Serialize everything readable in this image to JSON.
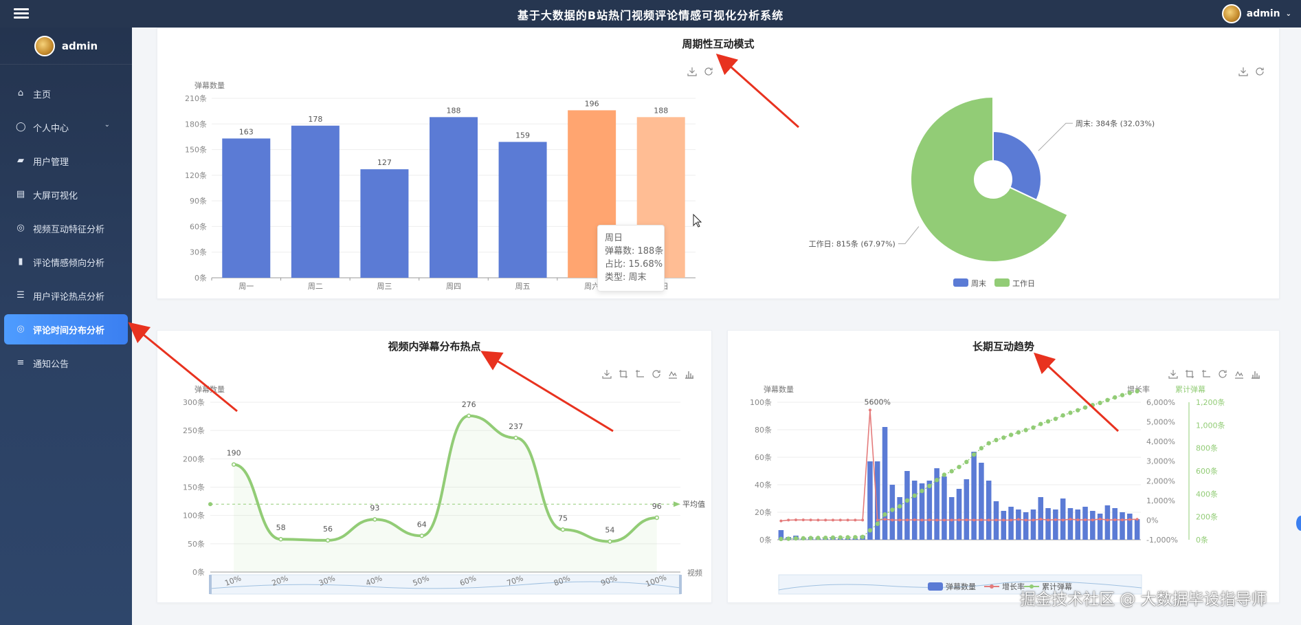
{
  "app": {
    "title": "基于大数据的B站热门视频评论情感可视化分析系统",
    "user": "admin"
  },
  "sidebar": {
    "user": "admin",
    "items": [
      {
        "label": "主页",
        "icon": "home-icon"
      },
      {
        "label": "个人中心",
        "icon": "user-icon",
        "has_children": true
      },
      {
        "label": "用户管理",
        "icon": "users-icon"
      },
      {
        "label": "大屏可视化",
        "icon": "clipboard-icon"
      },
      {
        "label": "视频互动特征分析",
        "icon": "compass-icon"
      },
      {
        "label": "评论情感倾向分析",
        "icon": "book-icon"
      },
      {
        "label": "用户评论热点分析",
        "icon": "sliders-icon"
      },
      {
        "label": "评论时间分布分析",
        "icon": "compass-icon",
        "active": true
      },
      {
        "label": "通知公告",
        "icon": "list-icon"
      }
    ]
  },
  "weekly": {
    "title": "周期性互动模式",
    "tooltip": {
      "line1": "周日",
      "line2": "弹幕数: 188条",
      "line3": "占比: 15.68%",
      "line4": "类型: 周末"
    }
  },
  "heat": {
    "title": "视频内弹幕分布热点"
  },
  "trend": {
    "title": "长期互动趋势"
  },
  "watermark": "掘金技术社区 @ 大数据毕设指导师",
  "colors": {
    "blue": "#5b7bd5",
    "orange": "#ffa570",
    "light_orange": "#ffbd94",
    "green": "#92cc76",
    "red": "#e47b7b",
    "accent": "#3b7ff0"
  },
  "chart_data": [
    {
      "type": "bar",
      "ylabel": "弹幕数量",
      "y_ticks": [
        "0条",
        "30条",
        "60条",
        "90条",
        "120条",
        "150条",
        "180条",
        "210条"
      ],
      "ylim": [
        0,
        210
      ],
      "categories": [
        "周一",
        "周二",
        "周三",
        "周四",
        "周五",
        "周六",
        "周日"
      ],
      "values": [
        163,
        178,
        127,
        188,
        159,
        196,
        188
      ],
      "data_labels": [
        "163",
        "178",
        "127",
        "188",
        "159",
        "196",
        "188"
      ],
      "bar_colors": [
        "#5b7bd5",
        "#5b7bd5",
        "#5b7bd5",
        "#5b7bd5",
        "#5b7bd5",
        "#ffa570",
        "#ffbd94"
      ]
    },
    {
      "type": "pie",
      "slices": [
        {
          "name": "周末",
          "value": 384,
          "percent": 32.03,
          "label": "周末: 384条 (32.03%)",
          "color": "#5b7bd5"
        },
        {
          "name": "工作日",
          "value": 815,
          "percent": 67.97,
          "label": "工作日: 815条 (67.97%)",
          "color": "#92cc76"
        }
      ],
      "legend": [
        "周末",
        "工作日"
      ],
      "legend_position": "bottom"
    },
    {
      "type": "line",
      "ylabel": "弹幕数量",
      "xlabel": "视频",
      "y_ticks": [
        "0条",
        "50条",
        "100条",
        "150条",
        "200条",
        "250条",
        "300条"
      ],
      "ylim": [
        0,
        300
      ],
      "x": [
        "10%",
        "20%",
        "30%",
        "40%",
        "50%",
        "60%",
        "70%",
        "80%",
        "90%",
        "100%"
      ],
      "values": [
        190,
        58,
        56,
        93,
        64,
        276,
        237,
        75,
        54,
        96
      ],
      "data_labels": [
        "190",
        "58",
        "56",
        "93",
        "64",
        "276",
        "237",
        "75",
        "54",
        "96"
      ],
      "mark_line": {
        "label": "平均值",
        "value": 120
      },
      "color": "#92cc76"
    },
    {
      "type": "bar",
      "ylabel": "弹幕数量",
      "y_ticks": [
        "0条",
        "20条",
        "40条",
        "60条",
        "80条",
        "100条"
      ],
      "ylim": [
        0,
        100
      ],
      "y2label": "增长率",
      "y2_ticks": [
        "-1,000%",
        "0%",
        "1,000%",
        "2,000%",
        "3,000%",
        "4,000%",
        "5,000%",
        "6,000%"
      ],
      "y3label": "累计弹幕",
      "y3_ticks": [
        "0条",
        "200条",
        "400条",
        "600条",
        "800条",
        "1,000条",
        "1,200条"
      ],
      "peak_label": "5600%",
      "legend": [
        "弹幕数量",
        "增长率",
        "累计弹幕"
      ],
      "series": [
        {
          "name": "弹幕数量",
          "values": [
            7,
            2,
            3,
            1,
            2,
            1,
            1,
            2,
            1,
            1,
            1,
            3,
            57,
            57,
            82,
            40,
            31,
            50,
            43,
            41,
            43,
            52,
            46,
            31,
            37,
            44,
            64,
            56,
            43,
            28,
            21,
            24,
            22,
            20,
            22,
            31,
            23,
            22,
            30,
            23,
            22,
            24,
            21,
            19,
            25,
            23,
            20,
            19,
            15
          ]
        },
        {
          "name": "增长率",
          "values": [
            -42.25,
            0,
            9,
            9,
            5,
            1,
            0,
            0,
            1,
            0,
            0,
            0,
            5600,
            1,
            42,
            3,
            4,
            6,
            15,
            1,
            6,
            1,
            2,
            3,
            7,
            10,
            3,
            10,
            1,
            5,
            1,
            3,
            32,
            0,
            1,
            47,
            3,
            21,
            4,
            45,
            12,
            15,
            5,
            56,
            3,
            17,
            10,
            29,
            41
          ]
        },
        {
          "name": "累计弹幕",
          "values": [
            7,
            9,
            12,
            13,
            15,
            16,
            17,
            19,
            20,
            21,
            22,
            25,
            82,
            139,
            221,
            261,
            292,
            342,
            385,
            426,
            469,
            521,
            567,
            598,
            635,
            679,
            743,
            799,
            842,
            870,
            891,
            915,
            937,
            957,
            979,
            1010,
            1033,
            1055,
            1085,
            1108,
            1130,
            1154,
            1175,
            1194,
            1219,
            1242,
            1262,
            1281,
            1296
          ]
        }
      ]
    }
  ]
}
